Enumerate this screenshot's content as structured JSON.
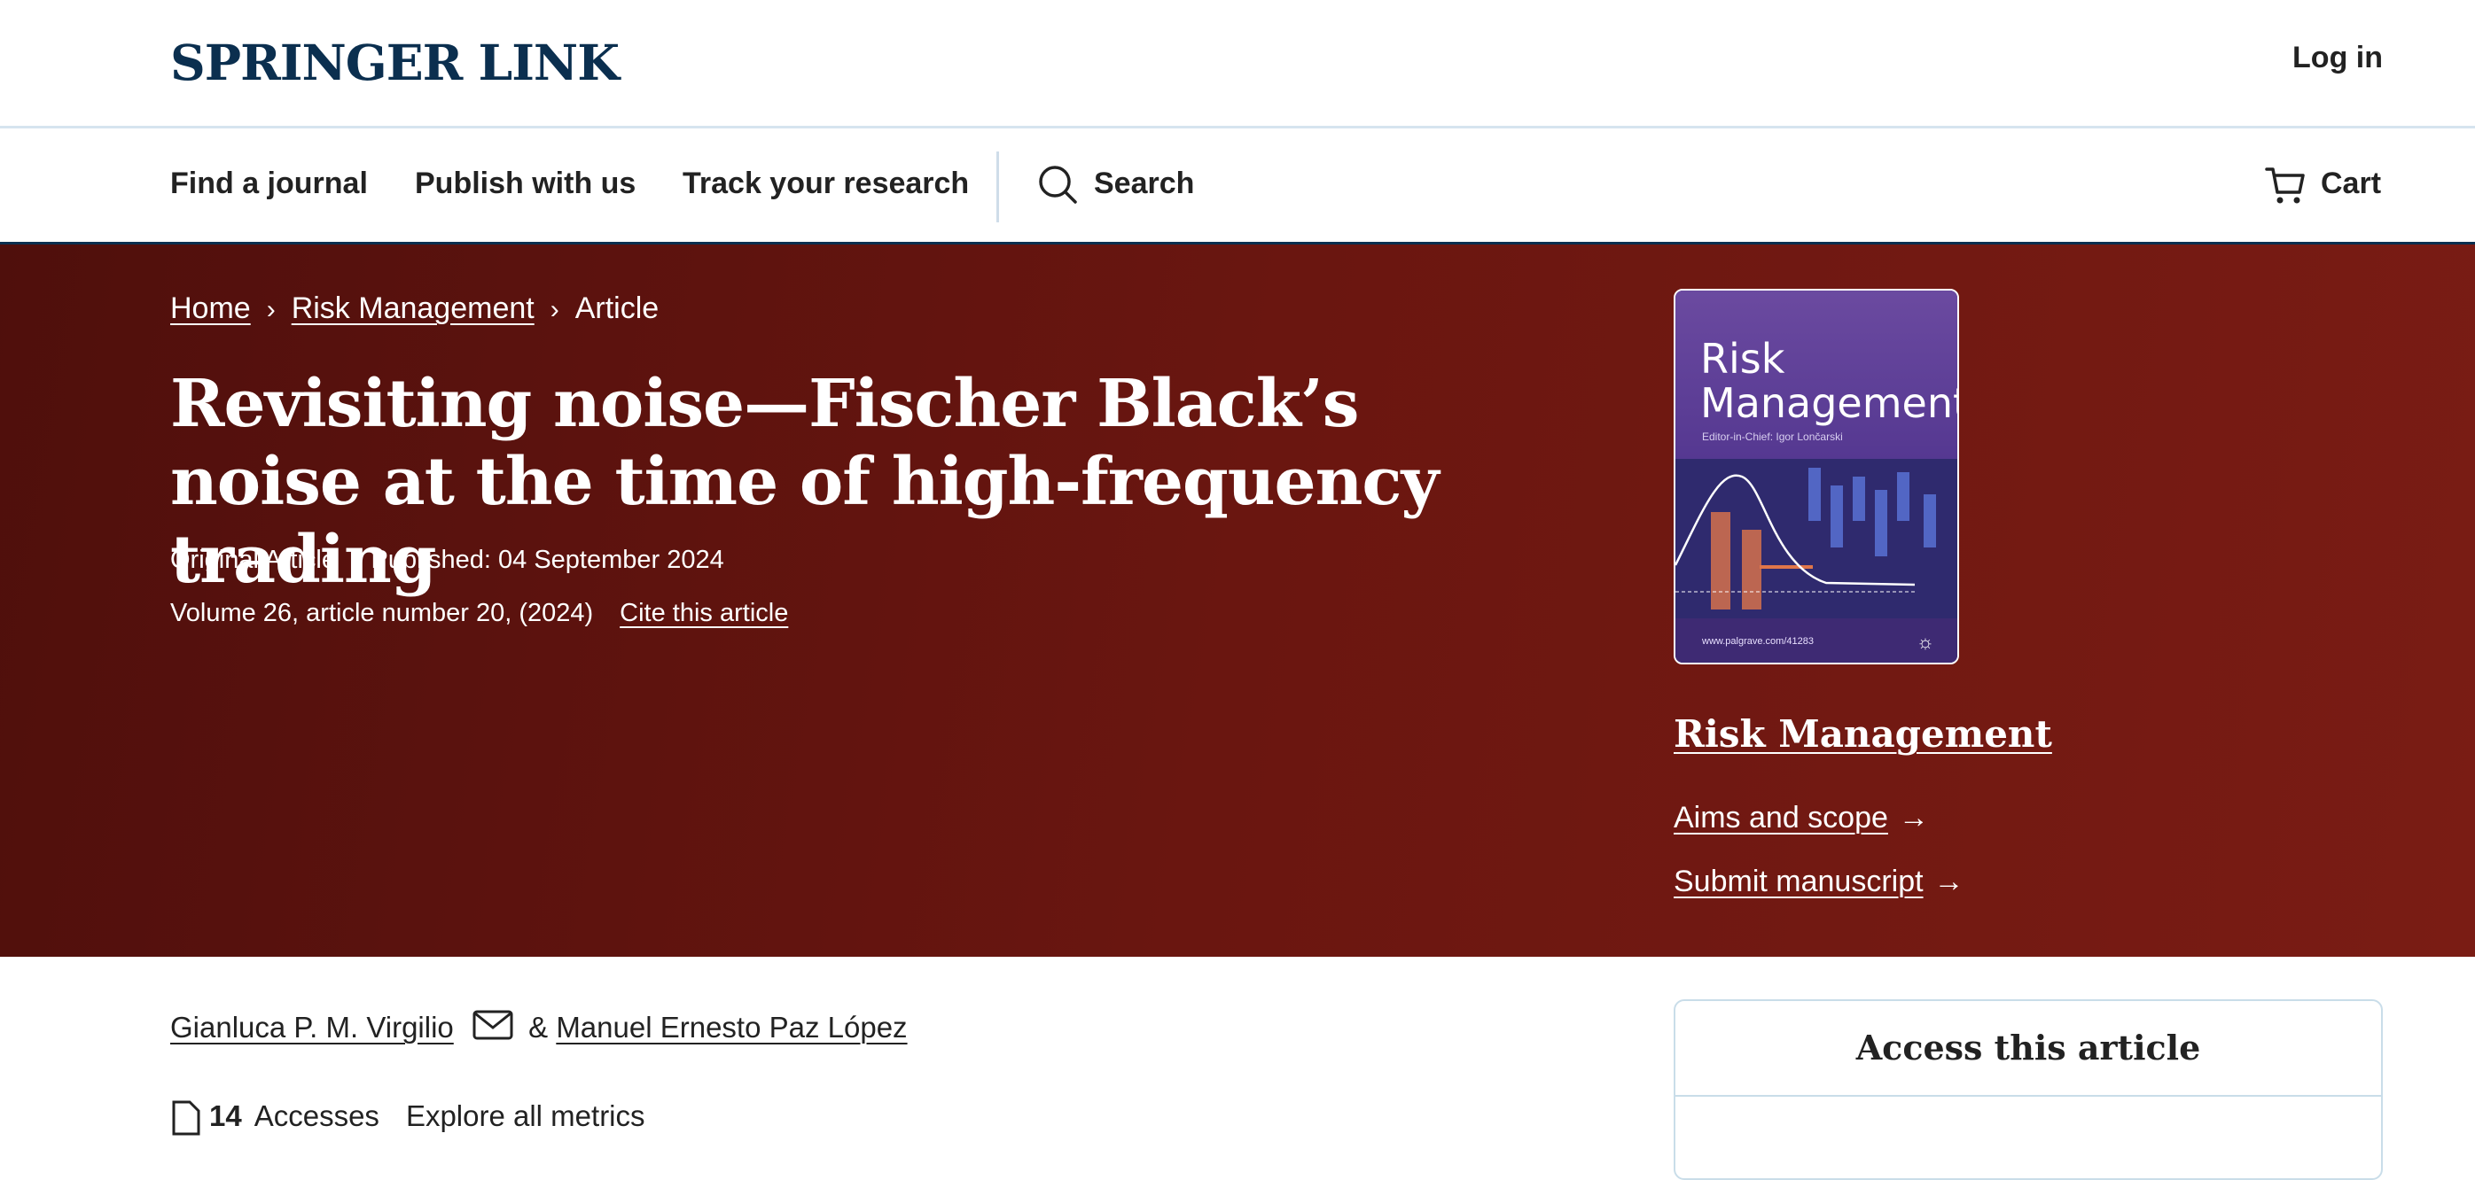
{
  "header": {
    "logo": "SPRINGER LINK",
    "login": "Log in"
  },
  "nav": {
    "find_journal": "Find a journal",
    "publish": "Publish with us",
    "track": "Track your research",
    "search": "Search",
    "cart": "Cart"
  },
  "breadcrumb": {
    "home": "Home",
    "journal": "Risk Management",
    "current": "Article"
  },
  "article": {
    "title": "Revisiting noise—Fischer Black’s noise at the time of high-frequency trading",
    "type": "Original Article",
    "published": "Published: 04 September 2024",
    "volume": "Volume 26, article number 20, (2024)",
    "cite": "Cite this article"
  },
  "cover": {
    "title_line1": "Risk",
    "title_line2": "Management",
    "editor": "Editor-in-Chief: Igor Lončarski",
    "url": "www.palgrave.com/41283"
  },
  "journal_panel": {
    "name": "Risk Management",
    "aims": "Aims and scope",
    "submit": "Submit manuscript"
  },
  "authors": {
    "author1": "Gianluca P. M. Virgilio",
    "sep": "&",
    "author2": "Manuel Ernesto Paz López"
  },
  "metrics": {
    "accesses_count": "14",
    "accesses_label": "Accesses",
    "explore": "Explore all metrics"
  },
  "access_box": {
    "title": "Access this article"
  },
  "colors": {
    "brand_navy": "#0b2f4f",
    "hero_red": "#6a1610",
    "border_light": "#c9dde9"
  }
}
